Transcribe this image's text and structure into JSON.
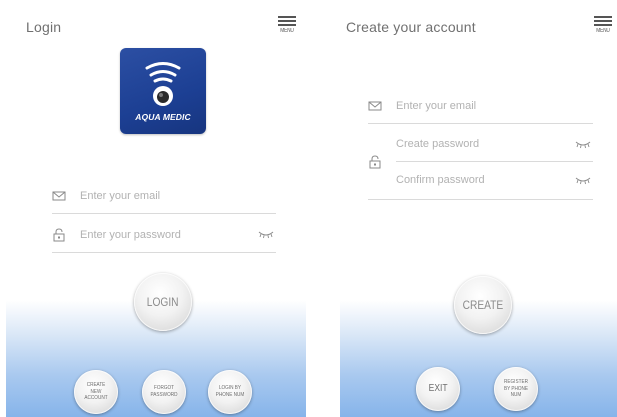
{
  "login_screen": {
    "title": "Login",
    "menu_label": "MENU",
    "logo_text": "AQUA MEDIC",
    "email_placeholder": "Enter your email",
    "password_placeholder": "Enter your password",
    "login_label": "LOGIN",
    "create_account_label": "CREATE NEW ACCOUNT",
    "forgot_password_label": "FORGOT PASSWORD",
    "login_by_phone_label": "LOGIN BY PHONE NUM"
  },
  "create_screen": {
    "title": "Create your account",
    "menu_label": "MENU",
    "email_placeholder": "Enter your email",
    "create_password_placeholder": "Create password",
    "confirm_password_placeholder": "Confirm password",
    "create_label": "CREATE",
    "exit_label": "EXIT",
    "register_by_phone_label": "REGISTER BY PHONE NUM"
  },
  "colors": {
    "logo_blue": "#1c3f93",
    "gradient_blue": "#86b4ea",
    "text_gray": "#707070",
    "placeholder_gray": "#b2b2b2"
  },
  "icons": {
    "menu": "hamburger-icon",
    "email": "envelope-icon",
    "password": "padlock-icon",
    "show_password": "eye-closed-icon",
    "logo": "wifi-signal-icon"
  }
}
